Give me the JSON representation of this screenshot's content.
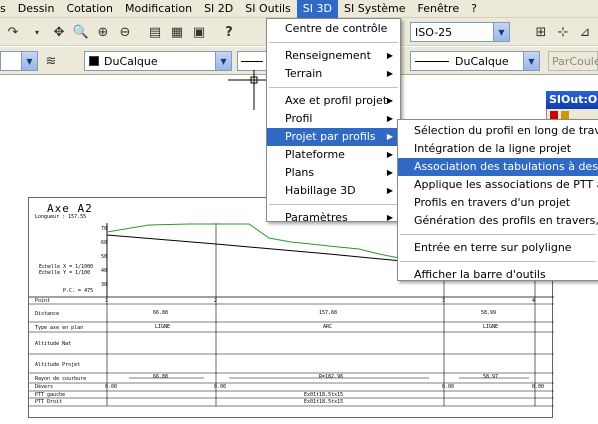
{
  "menubar": {
    "items": [
      "s",
      "Dessin",
      "Cotation",
      "Modification",
      "SI 2D",
      "SI Outils",
      "SI 3D",
      "SI Système",
      "Fenêtre",
      "?"
    ],
    "active": "SI 3D"
  },
  "toolbar": {
    "dimstyle_value": "ISO-25"
  },
  "properties": {
    "layer_value": "DuCalque",
    "linetype_value": "DuCalque",
    "plotstyle_value": "ParCoule"
  },
  "panel": {
    "title": "SIOut:Ob"
  },
  "si3d_menu": {
    "items": [
      {
        "label": "Centre de contrôle",
        "submenu": false
      },
      {
        "label": "Renseignement",
        "submenu": true
      },
      {
        "label": "Terrain",
        "submenu": true
      },
      {
        "label": "Axe et profil projet",
        "submenu": true
      },
      {
        "label": "Profil",
        "submenu": true
      },
      {
        "label": "Projet par profils",
        "submenu": true
      },
      {
        "label": "Plateforme",
        "submenu": true
      },
      {
        "label": "Plans",
        "submenu": true
      },
      {
        "label": "Habillage 3D",
        "submenu": true
      },
      {
        "label": "Paramètres",
        "submenu": true
      }
    ],
    "selected": "Projet par profils"
  },
  "submenu": {
    "items": [
      "Sélection du profil en long de travail",
      "Intégration de la ligne projet",
      "Association des tabulations à des profi",
      "Applique les associations de PTT à un p",
      "Profils en travers d'un projet",
      "Génération des profils en travers, mail",
      "Entrée en terre sur polyligne",
      "Afficher la barre d'outils"
    ],
    "selected": "Association des tabulations à des profi"
  },
  "drawing": {
    "title": "Axe A2",
    "longueur": "Longueur : 157.55",
    "echelle_x": "Echelle X = 1/1000",
    "echelle_y": "Echelle Y = 1/100",
    "pc": "P.C. = 475",
    "y_ticks": [
      "70",
      "60",
      "50",
      "40",
      "30"
    ],
    "row_labels": [
      "Point",
      "Distance",
      "Type axe en plan",
      "Altitude Nat",
      "Altitude Projet",
      "Rayon de courbure",
      "Dévers",
      "PTT gauche",
      "PTT Droit"
    ],
    "points": [
      "1",
      "2",
      "3",
      "4"
    ],
    "distances": [
      "66.88",
      "157.68",
      "58.99"
    ],
    "types": [
      "LIGNE",
      "ARC",
      "LIGNE"
    ],
    "rayon": [
      "66.88",
      "R=182.96",
      "58.97"
    ],
    "devers": [
      "0.00",
      "0.00",
      "0.00",
      "0.00"
    ],
    "ptt": [
      "Ex01t18.5tx15",
      "Ex01t18.5tx15"
    ]
  }
}
